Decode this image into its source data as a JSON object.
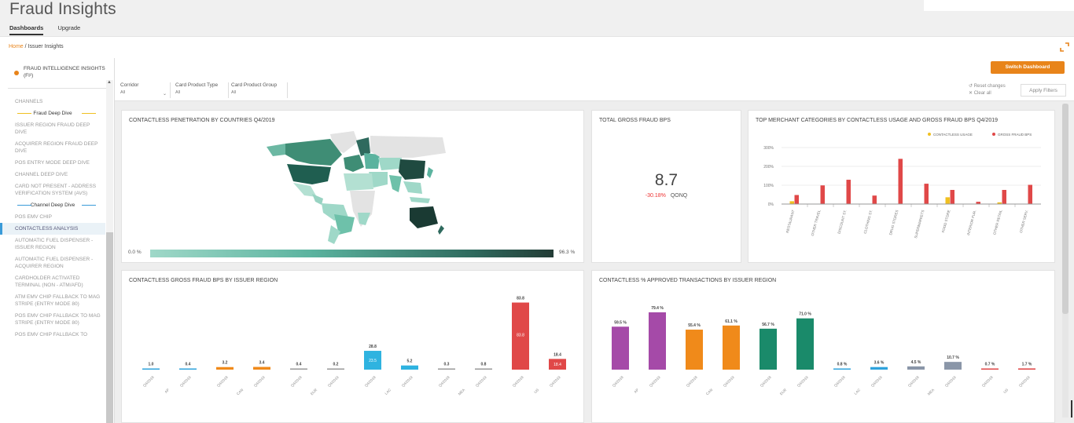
{
  "app": {
    "title": "Fraud Insights"
  },
  "topnav": {
    "dashboards": "Dashboards",
    "upgrade": "Upgrade"
  },
  "breadcrumb": {
    "home": "Home",
    "separator": " / ",
    "current": "Issuer Insights"
  },
  "sidebar": {
    "brand": "FRAUD INTELLIGENCE INSIGHTS (FI²)",
    "items": [
      {
        "label": "CHANNELS"
      },
      {
        "separator": "Fraud Deep Dive",
        "color": "#f0c020"
      },
      {
        "label": "ISSUER REGION FRAUD DEEP DIVE"
      },
      {
        "label": "ACQUIRER REGION FRAUD DEEP DIVE"
      },
      {
        "label": "POS ENTRY MODE DEEP DIVE"
      },
      {
        "label": "CHANNEL DEEP DIVE"
      },
      {
        "label": "CARD NOT PRESENT - ADDRESS VERIFICATION SYSTEM (AVS)"
      },
      {
        "separator": "Channel Deep Dive",
        "color": "#3a9bd9"
      },
      {
        "label": "POS EMV CHIP"
      },
      {
        "label": "CONTACTLESS ANALYSIS",
        "active": true
      },
      {
        "label": "AUTOMATIC FUEL DISPENSER - ISSUER REGION"
      },
      {
        "label": "AUTOMATIC FUEL DISPENSER - ACQUIRER REGION"
      },
      {
        "label": "CARDHOLDER ACTIVATED TERMINAL (NON - ATM/AFD)"
      },
      {
        "label": "ATM EMV CHIP FALLBACK TO MAG STRIPE (ENTRY MODE 80)"
      },
      {
        "label": "POS EMV CHIP FALLBACK TO MAG STRIPE (ENTRY MODE 80)"
      },
      {
        "label": "POS EMV CHIP FALLBACK TO"
      }
    ]
  },
  "filters": {
    "switch_dashboard": "Switch Dashboard",
    "items": [
      {
        "label": "Corridor",
        "value": "All"
      },
      {
        "label": "Card Product Type",
        "value": "All"
      },
      {
        "label": "Card Product Group",
        "value": "All"
      }
    ],
    "reset": "Reset changes",
    "clear": "Clear all",
    "apply": "Apply Filters"
  },
  "cards": {
    "map": {
      "title": "CONTACTLESS PENETRATION BY COUNTRIES Q4/2019",
      "min": "0.0 %",
      "max": "96.3 %"
    },
    "kpi": {
      "title": "TOTAL GROSS FRAUD BPS",
      "value": "8.7",
      "change": "-30.18%",
      "period": "QONQ"
    },
    "merchant": {
      "title": "TOP MERCHANT CATEGORIES BY CONTACTLESS USAGE AND GROSS FRAUD BPS Q4/2019"
    },
    "fraud_region": {
      "title": "CONTACTLESS GROSS FRAUD BPS BY ISSUER REGION"
    },
    "approved_region": {
      "title": "CONTACTLESS % APPROVED TRANSACTIONS BY ISSUER REGION"
    }
  },
  "chart_data": [
    {
      "type": "bar",
      "title": "TOP MERCHANT CATEGORIES BY CONTACTLESS USAGE AND GROSS FRAUD BPS Q4/2019",
      "categories": [
        "RESTAURANT",
        "OTHER TRAVEL",
        "DISCOUNT ST.",
        "CLOTHING ST.",
        "DRUG STORES",
        "SUPERMARKETS",
        "FOOD STORE",
        "INTERIOR FUR.",
        "OTHER RETAIL",
        "OTHER SERV."
      ],
      "series": [
        {
          "name": "CONTACTLESS USAGE",
          "color": "#f0c020",
          "values": [
            5,
            0,
            0,
            0,
            0,
            0,
            12,
            0,
            3,
            0
          ]
        },
        {
          "name": "GROSS FRAUD BPS",
          "color": "#e04848",
          "values": [
            16,
            33,
            43,
            15,
            80,
            36,
            25,
            4,
            25,
            34
          ]
        }
      ],
      "yticks": [
        "300%",
        "200%",
        "100%",
        "0%"
      ],
      "ylim": [
        0,
        100
      ],
      "legend": "top-right"
    },
    {
      "type": "bar",
      "title": "CONTACTLESS GROSS FRAUD BPS BY ISSUER REGION",
      "categories": [
        "Q4/2018",
        "Q4/2019",
        "Q4/2018",
        "Q4/2019",
        "Q4/2018",
        "Q4/2019",
        "Q4/2018",
        "Q4/2019",
        "Q4/2018",
        "Q4/2019",
        "Q4/2018",
        "Q4/2019"
      ],
      "groups": [
        "AP",
        "CAN",
        "EUR",
        "LAC",
        "MEA",
        "US"
      ],
      "values": [
        1.0,
        0.4,
        3.2,
        3.4,
        0.4,
        0.2,
        23.5,
        5.2,
        0.3,
        0.8,
        83.8,
        13.4
      ],
      "labels": [
        "1.0",
        "0.4",
        "3.2",
        "3.4",
        "0.4",
        "0.2",
        "28.8",
        "5.2",
        "0.3",
        "0.8",
        "83.8",
        "18.4"
      ],
      "inner_labels": [
        "",
        "",
        "",
        "",
        "",
        "",
        "23.5",
        "",
        "",
        "",
        "83.8",
        "18.4"
      ],
      "colors": [
        "#2fa3dc",
        "#2fa3dc",
        "#f08a1a",
        "#f08a1a",
        "#999999",
        "#999999",
        "#2fb3e0",
        "#2fb3e0",
        "#999999",
        "#999999",
        "#e04848",
        "#e04848"
      ],
      "ylim": [
        0,
        90
      ]
    },
    {
      "type": "bar",
      "title": "CONTACTLESS % APPROVED TRANSACTIONS BY ISSUER REGION",
      "categories": [
        "Q4/2018",
        "Q4/2019",
        "Q4/2018",
        "Q4/2019",
        "Q4/2018",
        "Q4/2019",
        "Q4/2018",
        "Q4/2019",
        "Q4/2018",
        "Q4/2019",
        "Q4/2018",
        "Q4/2019"
      ],
      "groups": [
        "AP",
        "CAN",
        "EUR",
        "LAC",
        "MEA",
        "US"
      ],
      "values": [
        59.5,
        79.4,
        55.4,
        61.1,
        56.7,
        71.0,
        0.8,
        3.6,
        4.5,
        10.7,
        0.7,
        1.7
      ],
      "labels": [
        "59.5 %",
        "79.4 %",
        "55.4 %",
        "61.1 %",
        "56.7 %",
        "71.0 %",
        "0.8 %",
        "3.6 %",
        "4.5 %",
        "10.7 %",
        "0.7 %",
        "1.7 %"
      ],
      "colors": [
        "#a54aa8",
        "#a54aa8",
        "#f08a1a",
        "#f08a1a",
        "#1a8a6a",
        "#1a8a6a",
        "#2fa3dc",
        "#2fa3dc",
        "#8a96a8",
        "#8a96a8",
        "#e04848",
        "#e04848"
      ],
      "ylim": [
        0,
        90
      ]
    }
  ]
}
